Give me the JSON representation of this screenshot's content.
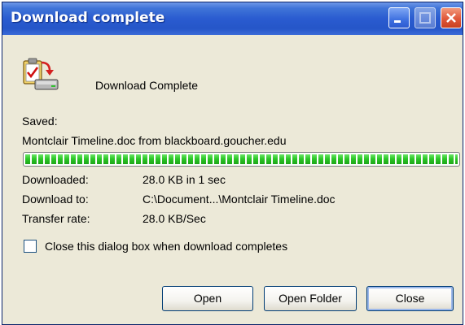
{
  "window": {
    "title": "Download complete"
  },
  "header": {
    "label": "Download Complete",
    "icon": "download-complete-icon"
  },
  "saved": {
    "label": "Saved:",
    "file_line": "Montclair Timeline.doc from blackboard.goucher.edu"
  },
  "progress": {
    "percent": 100,
    "color": "#27c222"
  },
  "details": {
    "downloaded_label": "Downloaded:",
    "downloaded_value": "28.0 KB in 1 sec",
    "download_to_label": "Download to:",
    "download_to_value": "C:\\Document...\\Montclair Timeline.doc",
    "transfer_rate_label": "Transfer rate:",
    "transfer_rate_value": "28.0 KB/Sec"
  },
  "options": {
    "close_when_complete_label": "Close this dialog box when download completes",
    "close_when_complete_checked": false
  },
  "buttons": {
    "open": "Open",
    "open_folder": "Open Folder",
    "close": "Close"
  },
  "colors": {
    "titlebar": "#2a5bd0",
    "dialog_background": "#ece9d8",
    "close_button": "#e0583a"
  }
}
